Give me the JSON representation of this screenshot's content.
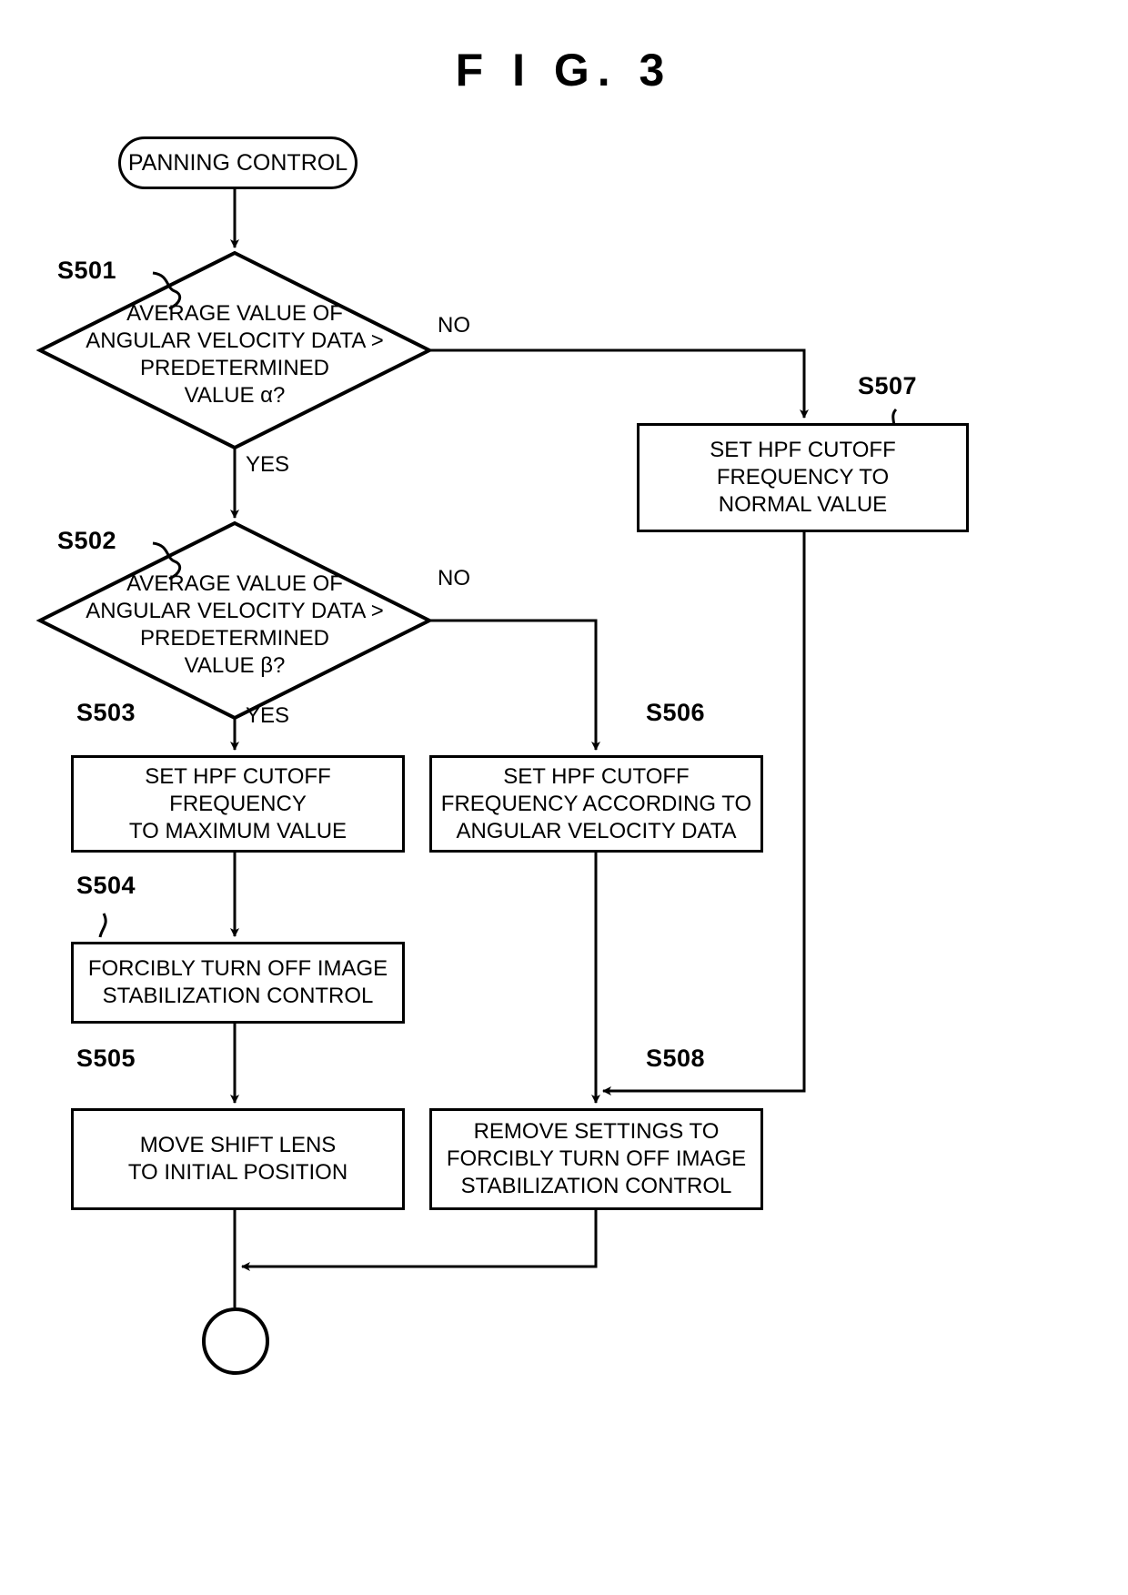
{
  "figure": {
    "title": "F I G.  3"
  },
  "flow": {
    "start": {
      "label": "PANNING CONTROL"
    },
    "end": {
      "label": ""
    },
    "decisions": [
      {
        "step": "S501",
        "text": "AVERAGE VALUE OF\nANGULAR VELOCITY DATA >\nPREDETERMINED\nVALUE α?",
        "yes_label": "YES",
        "no_label": "NO"
      },
      {
        "step": "S502",
        "text": "AVERAGE VALUE OF\nANGULAR VELOCITY DATA >\nPREDETERMINED\nVALUE β?",
        "yes_label": "YES",
        "no_label": "NO"
      }
    ],
    "processes": [
      {
        "step": "S503",
        "text": "SET HPF CUTOFF\nFREQUENCY\nTO MAXIMUM VALUE"
      },
      {
        "step": "S504",
        "text": "FORCIBLY TURN OFF IMAGE\nSTABILIZATION CONTROL"
      },
      {
        "step": "S505",
        "text": "MOVE SHIFT LENS\nTO INITIAL POSITION"
      },
      {
        "step": "S506",
        "text": "SET HPF CUTOFF\nFREQUENCY ACCORDING TO\nANGULAR VELOCITY DATA"
      },
      {
        "step": "S507",
        "text": "SET HPF CUTOFF\nFREQUENCY TO\nNORMAL VALUE"
      },
      {
        "step": "S508",
        "text": "REMOVE SETTINGS TO\nFORCIBLY TURN OFF IMAGE\nSTABILIZATION CONTROL"
      }
    ]
  },
  "colors": {
    "stroke": "#000000",
    "background": "#ffffff"
  }
}
